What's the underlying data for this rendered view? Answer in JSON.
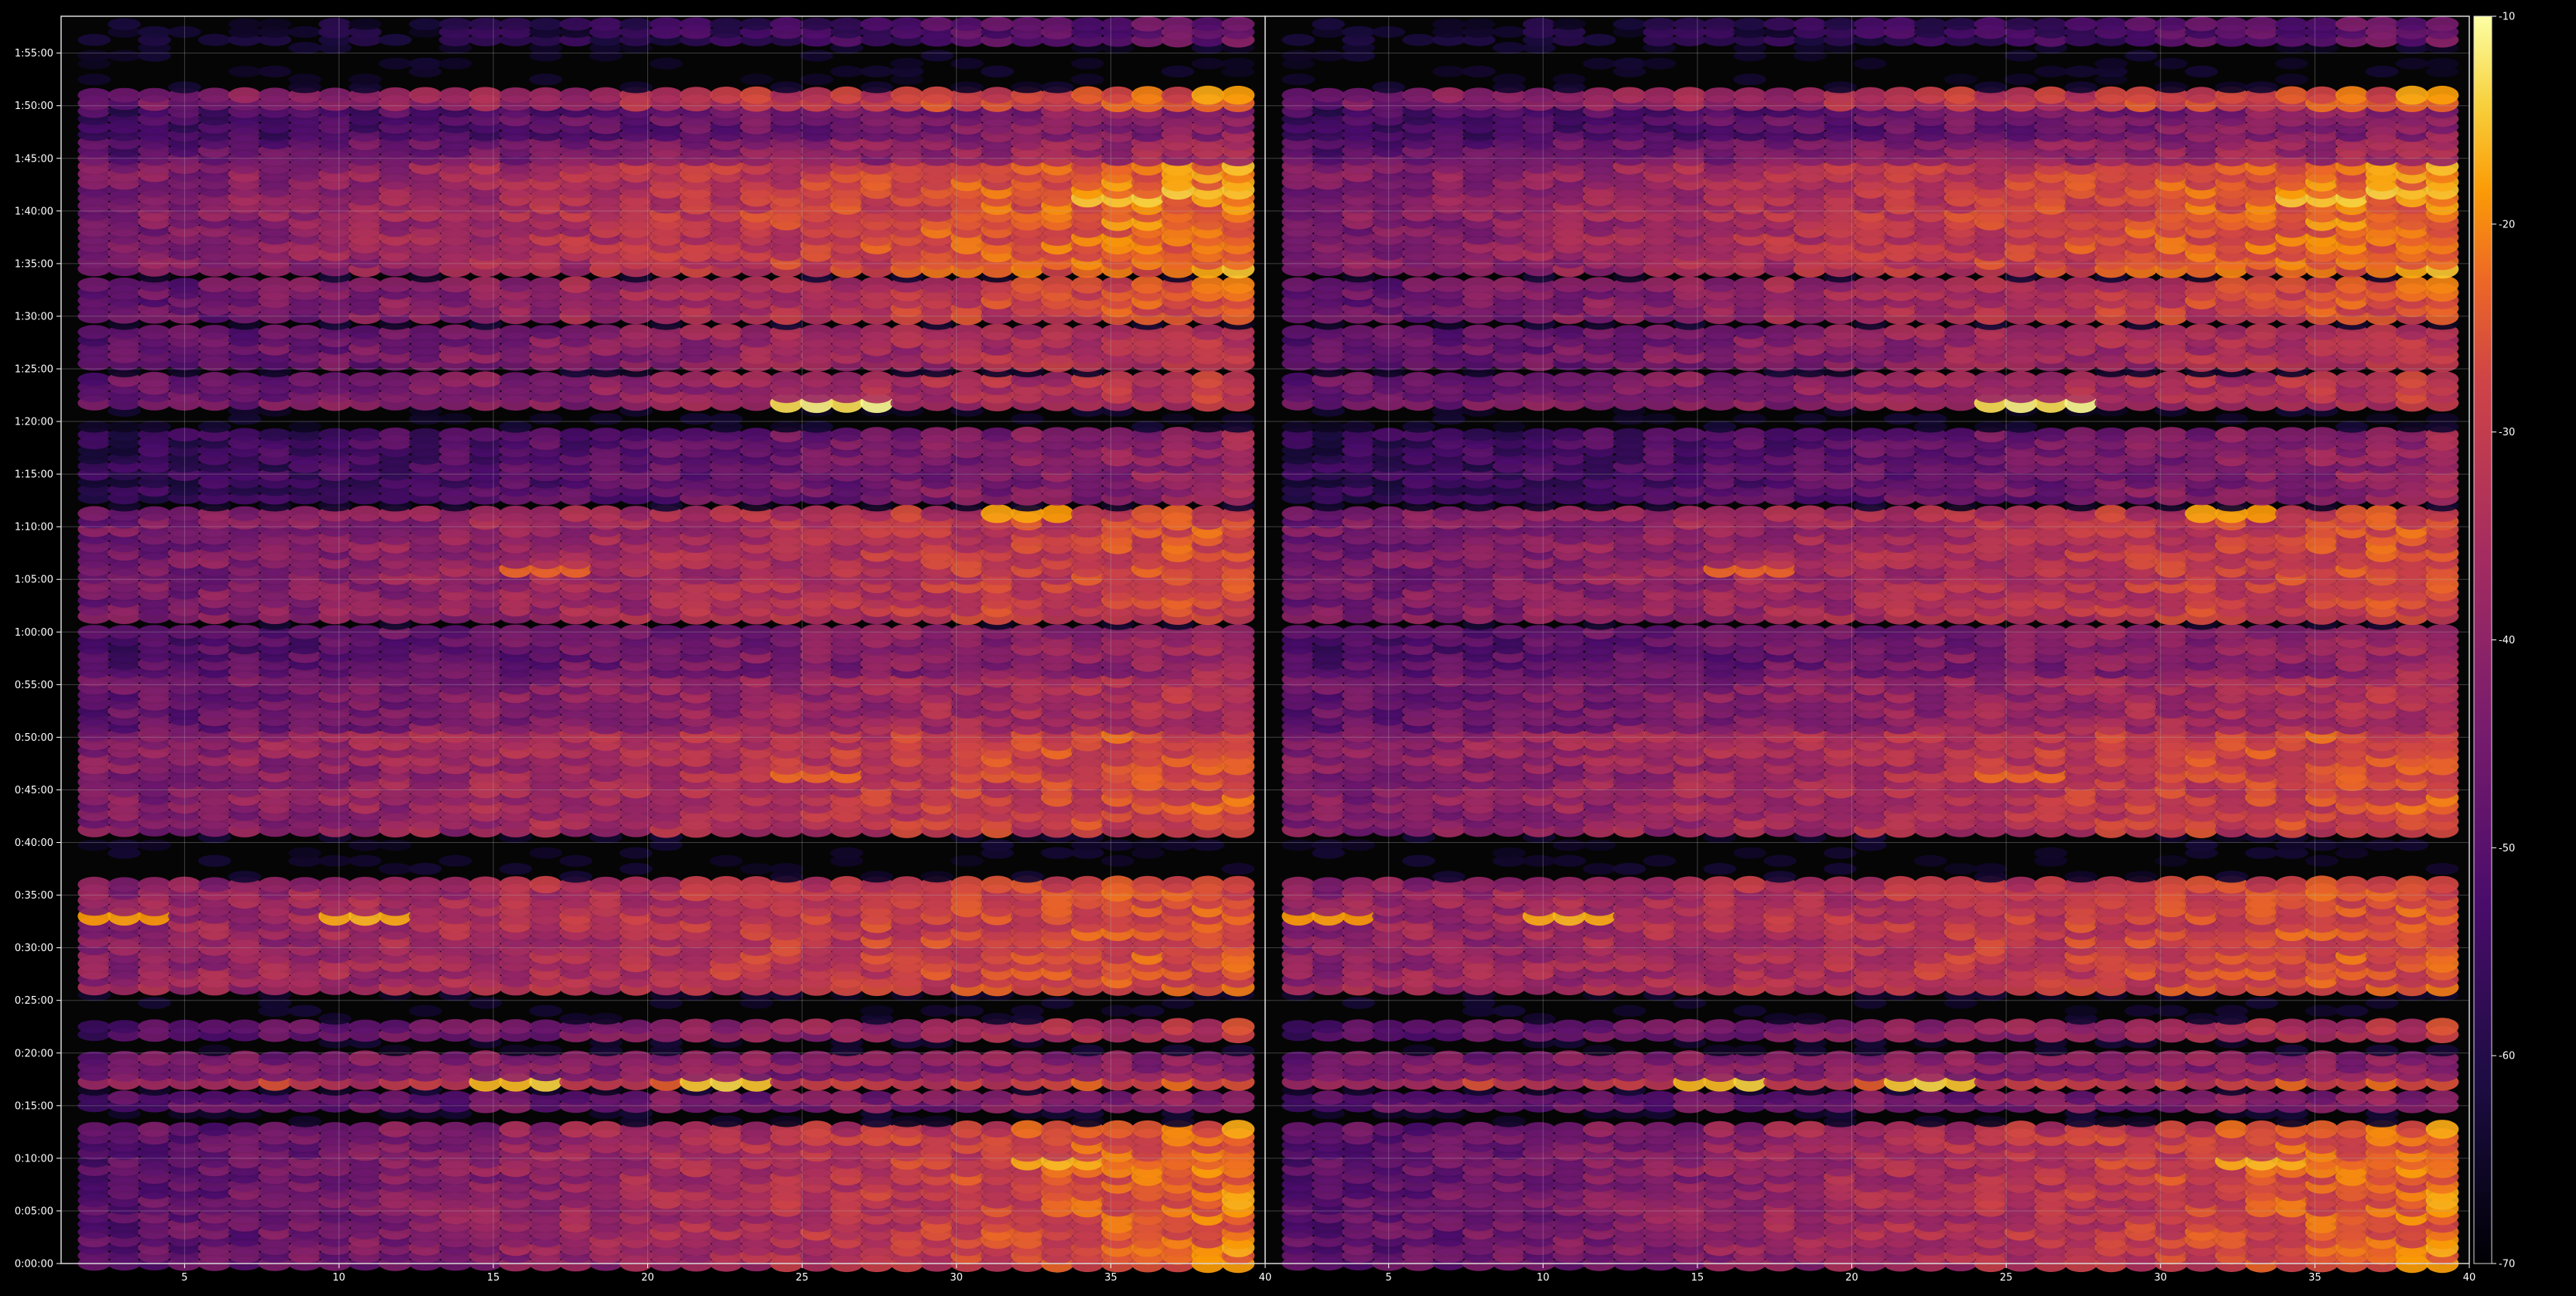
{
  "chart_data": {
    "type": "heatmap",
    "title": "",
    "xlabel": "",
    "ylabel": "",
    "colormap": "inferno",
    "background_color": "#000000",
    "grid": true,
    "marker": "ellipse",
    "panels": [
      {
        "xlim": [
          1,
          40
        ],
        "xticks": [
          5,
          10,
          15,
          20,
          25,
          30,
          35,
          40
        ]
      },
      {
        "xlim": [
          1,
          40
        ],
        "xticks": [
          5,
          10,
          15,
          20,
          25,
          30,
          35,
          40
        ]
      }
    ],
    "panels_identical": true,
    "y_axis": {
      "ylim": [
        "0:00:00",
        "1:58:30"
      ],
      "ytick_labels": [
        "0:00:00",
        "0:05:00",
        "0:10:00",
        "0:15:00",
        "0:20:00",
        "0:25:00",
        "0:30:00",
        "0:35:00",
        "0:40:00",
        "0:45:00",
        "0:50:00",
        "0:55:00",
        "1:00:00",
        "1:05:00",
        "1:10:00",
        "1:15:00",
        "1:20:00",
        "1:25:00",
        "1:30:00",
        "1:35:00",
        "1:40:00",
        "1:45:00",
        "1:50:00",
        "1:55:00"
      ],
      "row_step_seconds": 45
    },
    "colorbar": {
      "range": [
        -70,
        -10
      ],
      "tick_values": [
        -10,
        -20,
        -30,
        -40,
        -50,
        -60,
        -70
      ],
      "tick_labels": [
        "-10",
        "-20",
        "-30",
        "-40",
        "-50",
        "-60",
        "-70"
      ]
    },
    "bands": [
      {
        "from": "0:00:00",
        "to": "0:13:00",
        "at_x1": -50,
        "at_x40": -22
      },
      {
        "from": "0:14:30",
        "to": "0:16:00",
        "at_x1": -50,
        "at_x40": -40
      },
      {
        "from": "0:17:15",
        "to": "0:17:15",
        "at_x1": -32,
        "at_x40": -27
      },
      {
        "from": "0:18:00",
        "to": "0:20:00",
        "at_x1": -45,
        "at_x40": -40
      },
      {
        "from": "0:21:45",
        "to": "0:23:00",
        "at_x1": -52,
        "at_x40": -30
      },
      {
        "from": "0:26:15",
        "to": "0:26:15",
        "at_x1": -38,
        "at_x40": -25
      },
      {
        "from": "0:27:00",
        "to": "0:36:15",
        "at_x1": -40,
        "at_x40": -25
      },
      {
        "from": "0:41:15",
        "to": "0:47:15",
        "at_x1": -43,
        "at_x40": -26
      },
      {
        "from": "0:48:00",
        "to": "0:50:15",
        "at_x1": -42,
        "at_x40": -25
      },
      {
        "from": "0:51:00",
        "to": "0:55:30",
        "at_x1": -48,
        "at_x40": -32
      },
      {
        "from": "0:56:15",
        "to": "1:00:00",
        "at_x1": -52,
        "at_x40": -37
      },
      {
        "from": "1:01:30",
        "to": "1:11:15",
        "at_x1": -45,
        "at_x40": -26
      },
      {
        "from": "1:12:45",
        "to": "1:19:00",
        "at_x1": -58,
        "at_x40": -38
      },
      {
        "from": "1:21:30",
        "to": "1:24:15",
        "at_x1": -47,
        "at_x40": -30
      },
      {
        "from": "1:25:30",
        "to": "1:29:00",
        "at_x1": -50,
        "at_x40": -30
      },
      {
        "from": "1:30:00",
        "to": "1:33:00",
        "at_x1": -48,
        "at_x40": -24
      },
      {
        "from": "1:34:00",
        "to": "1:44:15",
        "at_x1": -44,
        "at_x40": -20
      },
      {
        "from": "1:44:45",
        "to": "1:46:30",
        "at_x1": -50,
        "at_x40": -35
      },
      {
        "from": "1:47:15",
        "to": "1:49:30",
        "at_x1": -55,
        "at_x40": -40
      },
      {
        "from": "1:49:45",
        "to": "1:51:15",
        "at_x1": -45,
        "at_x40": -22
      },
      {
        "from": "1:56:00",
        "to": "1:58:00",
        "at_x1": -68,
        "at_x40": -45
      }
    ],
    "hotspots": [
      {
        "x": 25.5,
        "y": "1:22:00",
        "value": -12
      },
      {
        "x": 38,
        "y": "1:41:45",
        "value": -14
      },
      {
        "x": 35,
        "y": "1:41:15",
        "value": -15
      },
      {
        "x": 10,
        "y": "0:33:15",
        "value": -16
      },
      {
        "x": 2,
        "y": "0:33:15",
        "value": -18
      },
      {
        "x": 15,
        "y": "0:17:30",
        "value": -15
      },
      {
        "x": 22,
        "y": "0:17:30",
        "value": -15
      },
      {
        "x": 33,
        "y": "0:09:45",
        "value": -17
      },
      {
        "x": 32,
        "y": "1:11:00",
        "value": -17
      },
      {
        "x": 16,
        "y": "1:05:45",
        "value": -22
      },
      {
        "x": 25,
        "y": "0:46:45",
        "value": -22
      }
    ]
  }
}
